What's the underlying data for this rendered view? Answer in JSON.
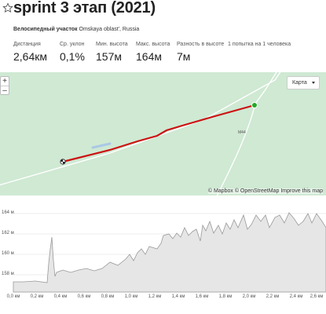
{
  "header": {
    "title": "sprint 3 этап (2021)",
    "subtitle_bold": "Велосипедный участок",
    "subtitle_rest": "Omskaya oblast', Russia"
  },
  "stats": [
    {
      "label": "Дистанция",
      "value": "2,64км"
    },
    {
      "label": "Ср. уклон",
      "value": "0,1%"
    },
    {
      "label": "Мин. высота",
      "value": "157м"
    },
    {
      "label": "Макс. высота",
      "value": "164м"
    },
    {
      "label": "Разность в высоте",
      "value": "7м"
    },
    {
      "label": "1 попытка на 1 человека",
      "value": ""
    }
  ],
  "map": {
    "zoom_in": "+",
    "zoom_out": "–",
    "map_type": "Карта",
    "road_label": "M44",
    "attribution": {
      "mapbox": "© Mapbox",
      "osm": "© OpenStreetMap",
      "improve": "Improve this map"
    },
    "colors": {
      "background": "#cfe9d3",
      "route": "#cc1111",
      "start": "#22aa22"
    }
  },
  "elevation": {
    "y_labels": [
      "164 м",
      "162 м",
      "160 м",
      "158 м"
    ],
    "x_labels": [
      "0,0 км",
      "0,2 км",
      "0,4 км",
      "0,6 км",
      "0,8 км",
      "1,0 км",
      "1,2 км",
      "1,4 км",
      "1,6 км",
      "1,8 км",
      "2,0 км",
      "2,2 км",
      "2,4 км",
      "2,6 км"
    ],
    "fill_color": "#e6e6e6",
    "line_color": "#999999"
  }
}
